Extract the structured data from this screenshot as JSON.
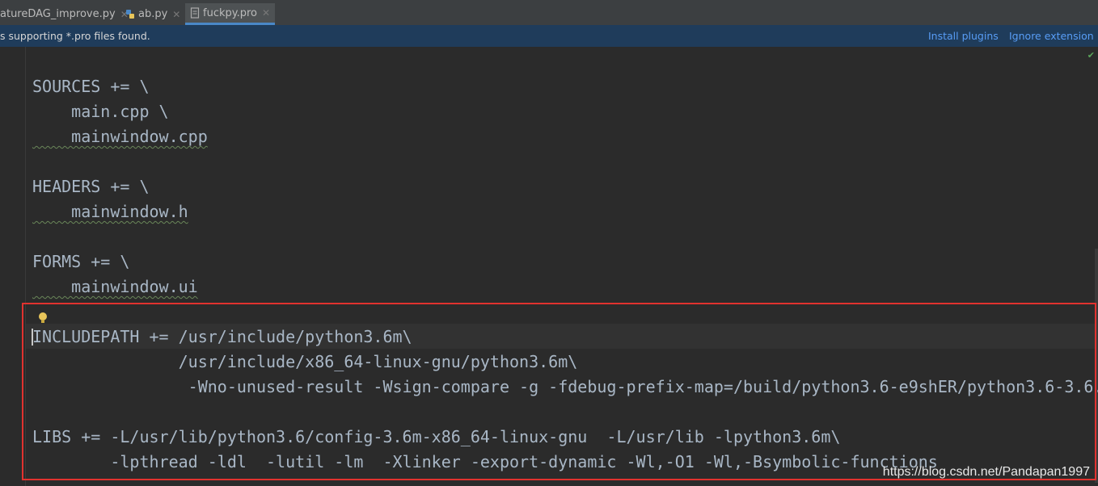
{
  "tabs": [
    {
      "label": "atureDAG_improve.py",
      "icon": "python-file-icon"
    },
    {
      "label": "ab.py",
      "icon": "python-file-icon"
    },
    {
      "label": "fuckpy.pro",
      "icon": "text-file-icon",
      "active": true
    }
  ],
  "notification": {
    "message": "s supporting *.pro files found.",
    "install_label": "Install plugins",
    "ignore_label": "Ignore extension"
  },
  "editor": {
    "lines": [
      "SOURCES += \\",
      "    main.cpp \\",
      "    mainwindow.cpp",
      "",
      "HEADERS += \\",
      "    mainwindow.h",
      "",
      "FORMS += \\",
      "    mainwindow.ui",
      "",
      "INCLUDEPATH += /usr/include/python3.6m\\",
      "               /usr/include/x86_64-linux-gnu/python3.6m\\",
      "                -Wno-unused-result -Wsign-compare -g -fdebug-prefix-map=/build/python3.6-e9shER/python3.6-3.6.",
      "",
      "LIBS += -L/usr/lib/python3.6/config-3.6m-x86_64-linux-gnu  -L/usr/lib -lpython3.6m\\",
      "        -lpthread -ldl  -lutil -lm  -Xlinker -export-dynamic -Wl,-O1 -Wl,-Bsymbolic-functions"
    ]
  },
  "watermark": "https://blog.csdn.net/Pandapan1997",
  "colors": {
    "highlight_box": "#e1322f",
    "notification_bg": "#1f3c5b",
    "link": "#589df6"
  }
}
